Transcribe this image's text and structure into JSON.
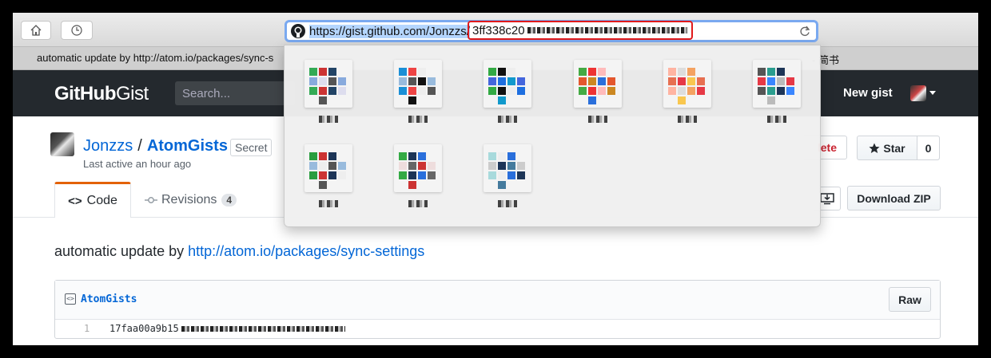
{
  "browser": {
    "url_prefix": "https://gist.github.com/Jonzzs/",
    "url_hash_visible": "3ff338c20",
    "tab_title": "automatic update by http://atom.io/packages/sync-s",
    "tab_title_suffix": "- 简书"
  },
  "top_sites": [
    {
      "icon": "site-thumbnail",
      "colors": [
        "#3a5",
        "#c33",
        "#246",
        "#8ad",
        "#dde",
        "#555"
      ]
    },
    {
      "icon": "site-thumbnail",
      "colors": [
        "#111",
        "#1a8fd6",
        "#e44",
        "#eee",
        "#9bd",
        "#555"
      ]
    },
    {
      "icon": "site-thumbnail",
      "colors": [
        "#1e6fe0",
        "#19c",
        "#3a4",
        "#111",
        "#eee",
        "#46d"
      ]
    },
    {
      "icon": "site-thumbnail",
      "colors": [
        "#e4572e",
        "#c82",
        "#2a6fdb",
        "#4a4",
        "#e33",
        "#fbb"
      ]
    },
    {
      "icon": "site-thumbnail",
      "colors": [
        "#f4a261",
        "#e76f51",
        "#e63946",
        "#f9c74f",
        "#ffb4a2",
        "#ddd"
      ]
    },
    {
      "icon": "site-thumbnail",
      "colors": [
        "#2a9d8f",
        "#1d3557",
        "#e63946",
        "#3a86ff",
        "#bbb",
        "#555"
      ]
    },
    {
      "icon": "site-thumbnail",
      "colors": [
        "#2a9d3f",
        "#c33",
        "#1d3557",
        "#9bd",
        "#eee",
        "#555"
      ]
    },
    {
      "icon": "site-thumbnail",
      "colors": [
        "#c33",
        "#3a4",
        "#1d3557",
        "#2a6fdb",
        "#edd",
        "#666"
      ]
    },
    {
      "icon": "site-thumbnail",
      "colors": [
        "#1d3557",
        "#457b9d",
        "#a8dadc",
        "#eee",
        "#2a6fdb",
        "#ccc"
      ]
    }
  ],
  "header": {
    "logo_bold": "GitHub",
    "logo_light": "Gist",
    "search_placeholder": "Search...",
    "new_gist": "New gist"
  },
  "repo": {
    "owner": "Jonzzs",
    "separator": "/",
    "name": "AtomGists",
    "visibility": "Secret",
    "last_active": "Last active an hour ago",
    "delete_label": "lete",
    "star_label": "Star",
    "star_count": "0"
  },
  "tabs": {
    "code": "Code",
    "revisions": "Revisions",
    "revisions_count": "4"
  },
  "actions": {
    "download_zip": "Download ZIP"
  },
  "description": {
    "prefix": "automatic update by ",
    "link": "http://atom.io/packages/sync-settings"
  },
  "file": {
    "name": "AtomGists",
    "raw": "Raw",
    "line_number": "1",
    "line_content": "17faa00a9b15"
  },
  "colors": {
    "header_bg": "#24292e",
    "link": "#0366d6",
    "active_tab_accent": "#e36209",
    "highlight_box": "#e0191b",
    "url_focus": "#7aa9f0"
  }
}
